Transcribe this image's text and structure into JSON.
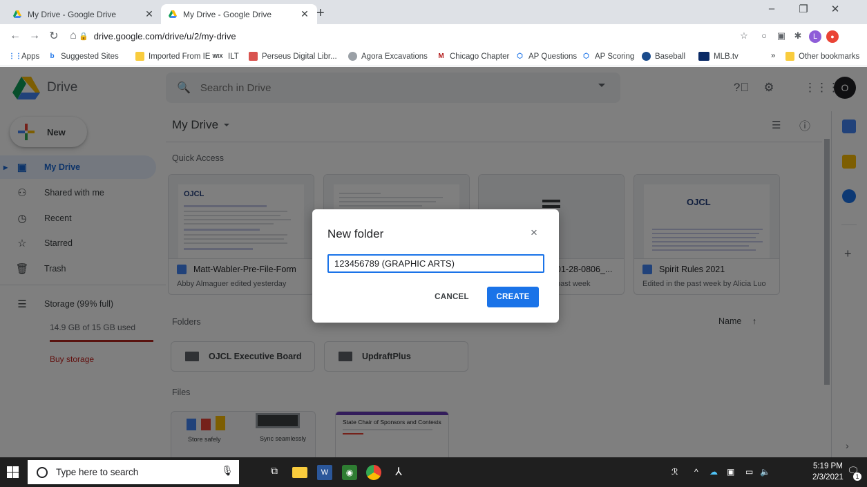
{
  "browser": {
    "tabs": [
      {
        "title": "My Drive - Google Drive",
        "active": false
      },
      {
        "title": "My Drive - Google Drive",
        "active": true
      }
    ],
    "new_tab": "+",
    "url": "drive.google.com/drive/u/2/my-drive",
    "window_controls": {
      "minimize": "–",
      "restore": "❐",
      "close": "✕"
    },
    "bookmarks": [
      {
        "label": "Apps",
        "icon": "apps-grid-icon"
      },
      {
        "label": "Suggested Sites",
        "icon": "bing-icon"
      },
      {
        "label": "Imported From IE",
        "icon": "folder-icon"
      },
      {
        "label": "ILT",
        "icon": "wix-icon"
      },
      {
        "label": "Perseus Digital Libr...",
        "icon": "perseus-icon"
      },
      {
        "label": "Agora Excavations",
        "icon": "agora-icon"
      },
      {
        "label": "Chicago Chapter",
        "icon": "m-logo-icon"
      },
      {
        "label": "AP Questions",
        "icon": "ap-icon"
      },
      {
        "label": "AP Scoring",
        "icon": "ap-icon"
      },
      {
        "label": "Baseball",
        "icon": "baseball-icon"
      },
      {
        "label": "MLB.tv",
        "icon": "mlb-icon"
      }
    ],
    "bookmarks_overflow": "»",
    "other_bookmarks": "Other bookmarks",
    "profile_letter": "L"
  },
  "drive": {
    "app_name": "Drive",
    "search_placeholder": "Search in Drive",
    "account_letter": "O",
    "new_label": "New",
    "nav": [
      {
        "label": "My Drive",
        "icon": "drive-folder-icon",
        "active": true
      },
      {
        "label": "Shared with me",
        "icon": "people-icon",
        "active": false
      },
      {
        "label": "Recent",
        "icon": "clock-icon",
        "active": false
      },
      {
        "label": "Starred",
        "icon": "star-icon",
        "active": false
      },
      {
        "label": "Trash",
        "icon": "trash-icon",
        "active": false
      }
    ],
    "storage": {
      "label": "Storage (99% full)",
      "used": "14.9 GB of 15 GB used",
      "fraction_used": 0.99,
      "buy": "Buy storage"
    },
    "breadcrumb": "My Drive",
    "quick_access_title": "Quick Access",
    "quick_access": [
      {
        "title": "Matt-Wabler-Pre-File-Form",
        "subtitle": "Abby Almaguer edited yesterday",
        "thumb_heading": "OJCL"
      },
      {
        "title": "",
        "subtitle": ""
      },
      {
        "title": "01-28-0806_...",
        "subtitle": "past week"
      },
      {
        "title": "Spirit Rules 2021",
        "subtitle": "Edited in the past week by Alicia Luo",
        "thumb_heading": "OJCL"
      }
    ],
    "folders_title": "Folders",
    "sort_label": "Name",
    "sort_arrow": "↑",
    "folders": [
      {
        "name": "OJCL Executive Board"
      },
      {
        "name": "UpdraftPlus"
      }
    ],
    "files_title": "Files",
    "files": [
      {
        "caption": "Store safely"
      },
      {
        "caption": "Sync seamlessly"
      },
      {
        "caption": "State Chair of Sponsors and Contests"
      }
    ]
  },
  "dialog": {
    "title": "New folder",
    "close": "×",
    "input_value": "123456789 (GRAPHIC ARTS)",
    "cancel": "CANCEL",
    "create": "CREATE"
  },
  "taskbar": {
    "search_placeholder": "Type here to search",
    "time": "5:19 PM",
    "date": "2/3/2021",
    "notification_count": "1"
  },
  "colors": {
    "accent_blue": "#1a73e8",
    "active_nav_bg": "#e8f0fe",
    "storage_red": "#b3261e",
    "buy_storage_red": "#c5221f"
  }
}
